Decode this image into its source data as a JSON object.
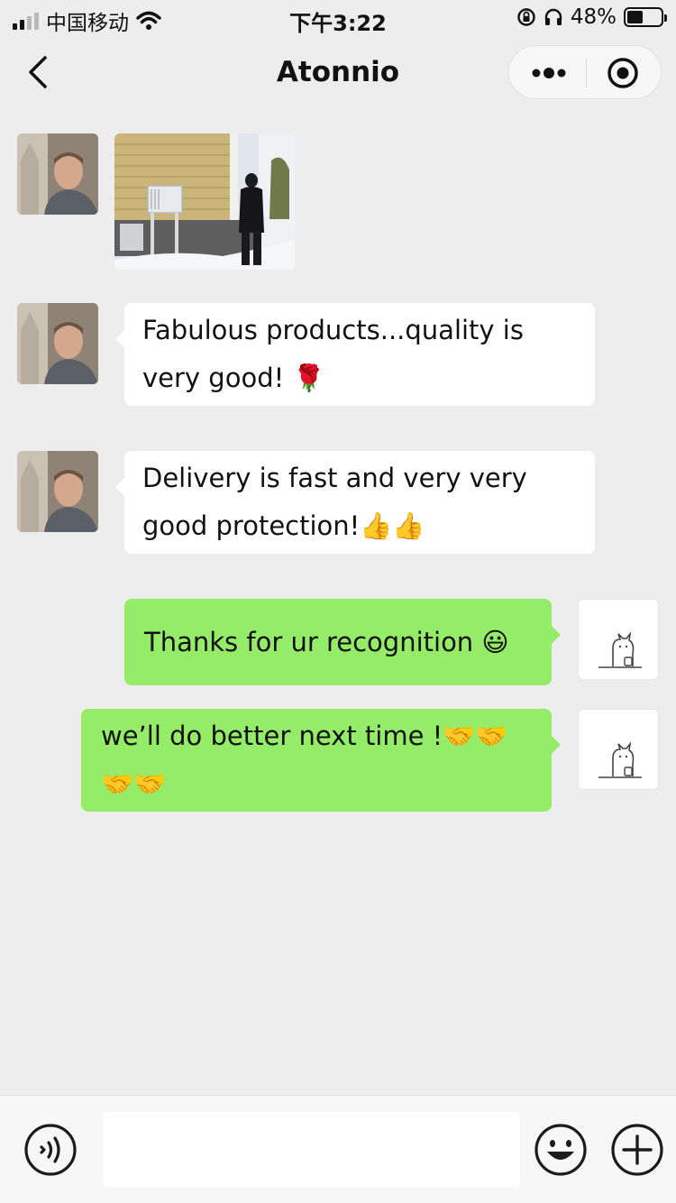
{
  "status_bar": {
    "carrier": "中国移动",
    "time": "下午3:22",
    "battery_text": "48%",
    "battery_level": 0.48
  },
  "nav": {
    "title": "Atonnio",
    "back_icon": "chevron-left-icon",
    "more_icon": "more-dots-icon",
    "close_icon": "target-circle-icon"
  },
  "messages": [
    {
      "side": "in",
      "type": "image",
      "sender": "customer"
    },
    {
      "side": "in",
      "type": "text",
      "lines": [
        "Fabulous products...quality is",
        "very good!  🌹"
      ]
    },
    {
      "side": "in",
      "type": "text",
      "lines": [
        "Delivery is fast and very very",
        "good protection!👍👍"
      ]
    },
    {
      "side": "out",
      "type": "text",
      "lines": [
        "Thanks for ur recognition 😃"
      ]
    },
    {
      "side": "out",
      "type": "text",
      "lines": [
        "we’ll do better next time !🤝🤝",
        "🤝🤝"
      ]
    }
  ],
  "input_bar": {
    "voice_icon": "voice-icon",
    "input_value": "",
    "emoji_icon": "emoji-icon",
    "plus_icon": "plus-icon"
  },
  "colors": {
    "background": "#ededed",
    "bubble_out": "#95ec69",
    "bubble_in": "#ffffff"
  }
}
